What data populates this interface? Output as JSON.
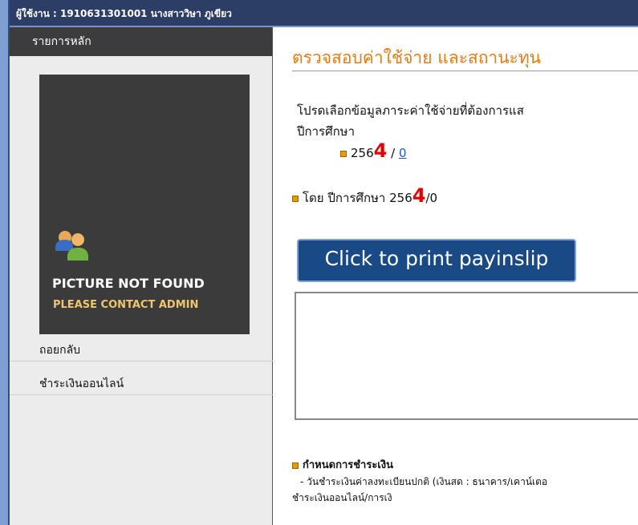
{
  "user_bar": {
    "text": "ผู้ใช้งาน : 1910631301001 นางสาววิษา ภูเขียว"
  },
  "sidebar": {
    "title": "รายการหลัก",
    "avatar": {
      "line1": "PICTURE NOT FOUND",
      "line2": "PLEASE CONTACT ADMIN"
    },
    "items": [
      {
        "label": "ถอยกลับ"
      },
      {
        "label": "ชำระเงินออนไลน์"
      }
    ]
  },
  "main": {
    "heading": "ตรวจสอบค่าใช้จ่าย และสถานะทุน",
    "instruction": "โปรดเลือกข้อมูลภาระค่าใช้จ่ายที่ต้องการแส",
    "academic_year_label": "ปีการศึกษา",
    "year_prefix": "256",
    "year_digit": "4",
    "year_sep": " / ",
    "semester": "0",
    "by_year_prefix": "โดย ปีการศึกษา 256",
    "by_year_digit": "4",
    "by_year_suffix": "/0",
    "print_button": "Click to print payinslip",
    "payment_heading": "กำหนดการชำระเงิน",
    "payment_line1": "- วันชำระเงินค่าลงทะเบียนปกติ (เงินสด : ธนาคาร/เคาน์เตอ",
    "payment_line2": "ชำระเงินออนไลน์/การเงิ"
  },
  "colors": {
    "topbar": "#2c3e66",
    "heading": "#e87b14",
    "accent_red": "#e10000",
    "button": "#1a4a86"
  }
}
